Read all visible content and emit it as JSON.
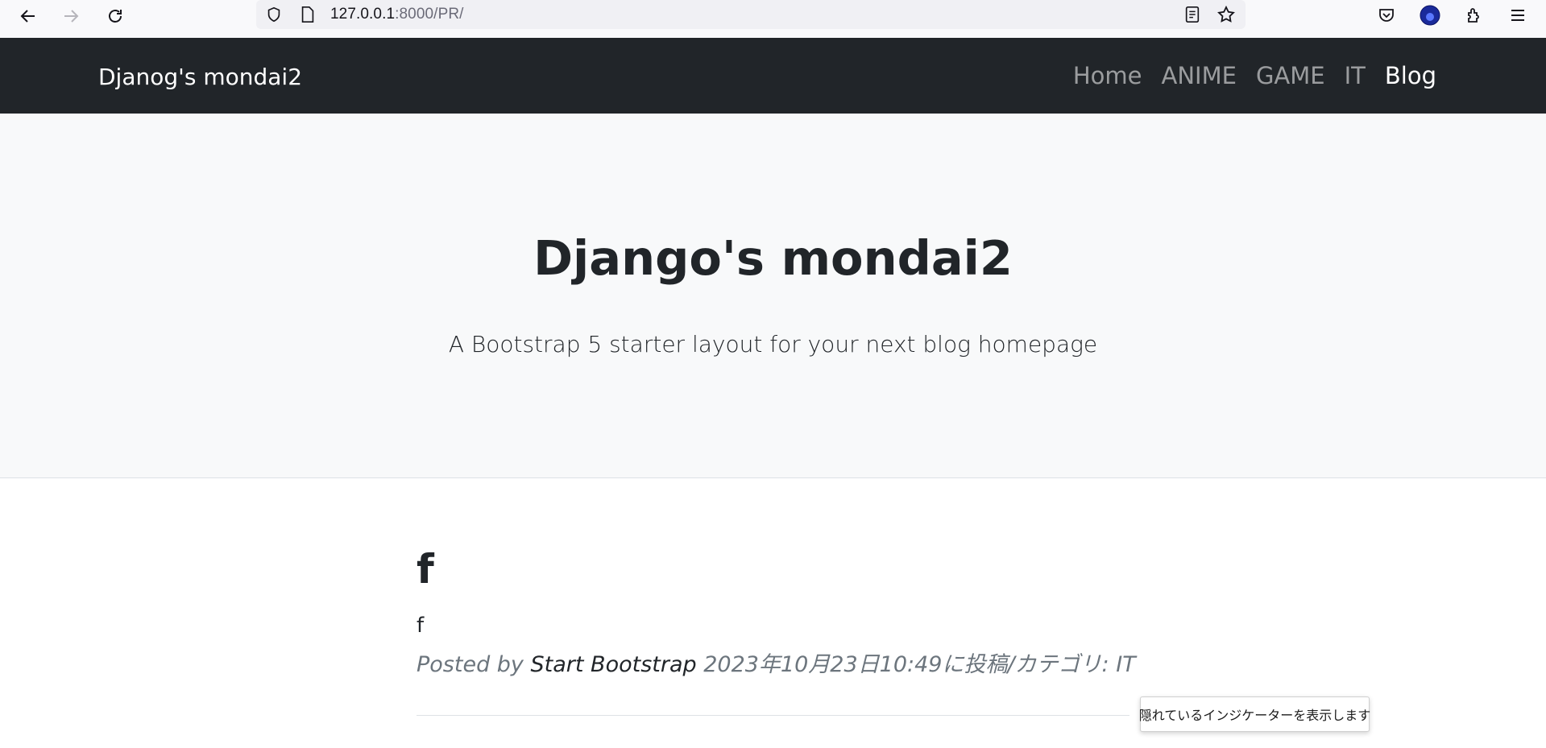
{
  "browser": {
    "url_host": "127.0.0.1",
    "url_rest": ":8000/PR/",
    "icons": [
      "back-arrow-icon",
      "forward-arrow-icon",
      "reload-icon",
      "shield-icon",
      "page-icon",
      "reader-view-icon",
      "bookmark-star-icon",
      "pocket-icon",
      "account-avatar-icon",
      "extensions-icon",
      "menu-icon"
    ]
  },
  "navbar": {
    "brand": "Djanog's mondai2",
    "links": [
      {
        "label": "Home",
        "active": false
      },
      {
        "label": "ANIME",
        "active": false
      },
      {
        "label": "GAME",
        "active": false
      },
      {
        "label": "IT",
        "active": false
      },
      {
        "label": "Blog",
        "active": true
      }
    ]
  },
  "header": {
    "title": "Django's mondai2",
    "lead": "A Bootstrap 5 starter layout for your next blog homepage"
  },
  "post": {
    "title": "f",
    "body": "f",
    "meta_prefix": "Posted by ",
    "author": "Start Bootstrap",
    "meta_suffix": " 2023年10月23日10:49に投稿/カテゴリ: IT"
  },
  "tooltip": {
    "text": "隠れているインジケーターを表示します"
  },
  "colors": {
    "navbar_bg": "#212529",
    "header_bg": "#f8f9fa",
    "muted": "#6c757d"
  }
}
